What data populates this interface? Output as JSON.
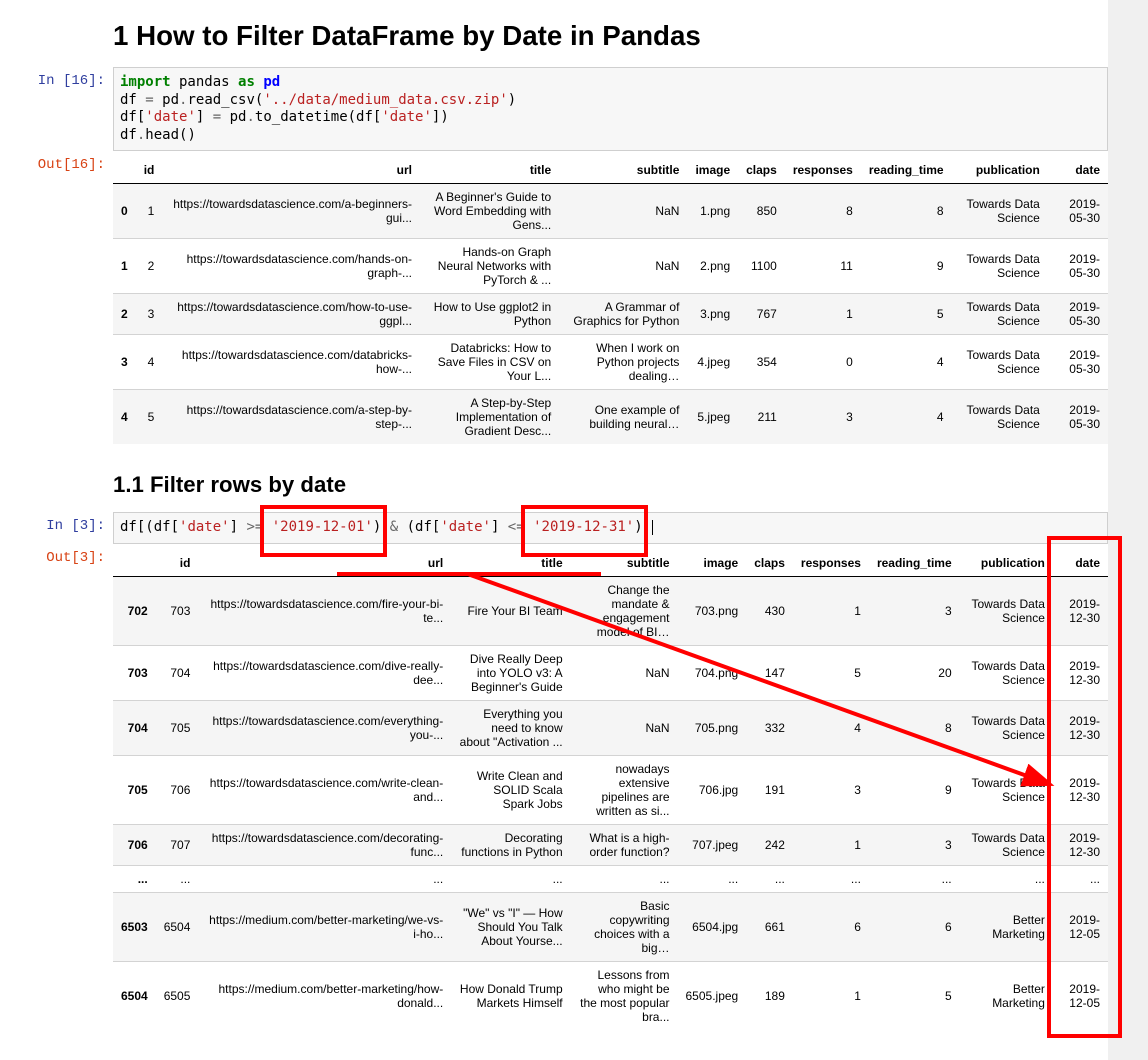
{
  "heading1": "1  How to Filter DataFrame by Date in Pandas",
  "heading11": "1.1  Filter rows by date",
  "prompt_in16": "In [16]:",
  "prompt_out16": "Out[16]:",
  "prompt_in3": "In [3]:",
  "prompt_out3": "Out[3]:",
  "code1": {
    "l1a": "import",
    "l1b": " pandas ",
    "l1c": "as",
    "l1d": " ",
    "l1e": "pd",
    "l2a": "df ",
    "l2b": "=",
    "l2c": " pd",
    "l2d": ".",
    "l2e": "read_csv(",
    "l2f": "'../data/medium_data.csv.zip'",
    "l2g": ")",
    "l3a": "df[",
    "l3b": "'date'",
    "l3c": "] ",
    "l3d": "=",
    "l3e": " pd",
    "l3f": ".",
    "l3g": "to_datetime(df[",
    "l3h": "'date'",
    "l3i": "])",
    "l4a": "df",
    "l4b": ".",
    "l4c": "head()"
  },
  "code2": {
    "a1": "df[(df[",
    "a2": "'date'",
    "a3": "] ",
    "a4": ">=",
    "a5": " ",
    "a6": "'2019-12-01'",
    "a7": ") ",
    "a8": "&",
    "a9": " (df[",
    "a10": "'date'",
    "a11": "] ",
    "a12": "<=",
    "a13": " ",
    "a14": "'2019-12-31'",
    "a15": ")]"
  },
  "t1_headers": [
    "",
    "id",
    "url",
    "title",
    "subtitle",
    "image",
    "claps",
    "responses",
    "reading_time",
    "publication",
    "date"
  ],
  "t2_headers": [
    "",
    "id",
    "url",
    "title",
    "subtitle",
    "image",
    "claps",
    "responses",
    "reading_time",
    "publication",
    "date"
  ],
  "t1": [
    {
      "idx": "0",
      "id": "1",
      "url": "https://towardsdatascience.com/a-beginners-gui...",
      "title": "A Beginner's Guide to Word Embedding with Gens...",
      "subtitle": "NaN",
      "image": "1.png",
      "claps": "850",
      "responses": "8",
      "reading_time": "8",
      "publication": "Towards Data Science",
      "date": "2019-05-30"
    },
    {
      "idx": "1",
      "id": "2",
      "url": "https://towardsdatascience.com/hands-on-graph-...",
      "title": "Hands-on Graph Neural Networks with PyTorch & ...",
      "subtitle": "NaN",
      "image": "2.png",
      "claps": "1100",
      "responses": "11",
      "reading_time": "9",
      "publication": "Towards Data Science",
      "date": "2019-05-30"
    },
    {
      "idx": "2",
      "id": "3",
      "url": "https://towardsdatascience.com/how-to-use-ggpl...",
      "title": "How to Use ggplot2 in Python",
      "subtitle": "A Grammar of Graphics for Python",
      "image": "3.png",
      "claps": "767",
      "responses": "1",
      "reading_time": "5",
      "publication": "Towards Data Science",
      "date": "2019-05-30"
    },
    {
      "idx": "3",
      "id": "4",
      "url": "https://towardsdatascience.com/databricks-how-...",
      "title": "Databricks: How to Save Files in CSV on Your L...",
      "subtitle": "When I work on Python projects dealing…",
      "image": "4.jpeg",
      "claps": "354",
      "responses": "0",
      "reading_time": "4",
      "publication": "Towards Data Science",
      "date": "2019-05-30"
    },
    {
      "idx": "4",
      "id": "5",
      "url": "https://towardsdatascience.com/a-step-by-step-...",
      "title": "A Step-by-Step Implementation of Gradient Desc...",
      "subtitle": "One example of building neural…",
      "image": "5.jpeg",
      "claps": "211",
      "responses": "3",
      "reading_time": "4",
      "publication": "Towards Data Science",
      "date": "2019-05-30"
    }
  ],
  "t2": [
    {
      "idx": "702",
      "id": "703",
      "url": "https://towardsdatascience.com/fire-your-bi-te...",
      "title": "Fire Your BI Team",
      "subtitle": "Change the mandate & engagement model of BI…",
      "image": "703.png",
      "claps": "430",
      "responses": "1",
      "reading_time": "3",
      "publication": "Towards Data Science",
      "date": "2019-12-30"
    },
    {
      "idx": "703",
      "id": "704",
      "url": "https://towardsdatascience.com/dive-really-dee...",
      "title": "Dive Really Deep into YOLO v3: A Beginner's Guide",
      "subtitle": "NaN",
      "image": "704.png",
      "claps": "147",
      "responses": "5",
      "reading_time": "20",
      "publication": "Towards Data Science",
      "date": "2019-12-30"
    },
    {
      "idx": "704",
      "id": "705",
      "url": "https://towardsdatascience.com/everything-you-...",
      "title": "Everything you need to know about \"Activation ...",
      "subtitle": "NaN",
      "image": "705.png",
      "claps": "332",
      "responses": "4",
      "reading_time": "8",
      "publication": "Towards Data Science",
      "date": "2019-12-30"
    },
    {
      "idx": "705",
      "id": "706",
      "url": "https://towardsdatascience.com/write-clean-and...",
      "title": "Write Clean and SOLID Scala Spark Jobs",
      "subtitle": "nowadays extensive pipelines are written as si...",
      "image": "706.jpg",
      "claps": "191",
      "responses": "3",
      "reading_time": "9",
      "publication": "Towards Data Science",
      "date": "2019-12-30"
    },
    {
      "idx": "706",
      "id": "707",
      "url": "https://towardsdatascience.com/decorating-func...",
      "title": "Decorating functions in Python",
      "subtitle": "What is a high-order function?",
      "image": "707.jpeg",
      "claps": "242",
      "responses": "1",
      "reading_time": "3",
      "publication": "Towards Data Science",
      "date": "2019-12-30"
    },
    {
      "idx": "...",
      "id": "...",
      "url": "...",
      "title": "...",
      "subtitle": "...",
      "image": "...",
      "claps": "...",
      "responses": "...",
      "reading_time": "...",
      "publication": "...",
      "date": "..."
    },
    {
      "idx": "6503",
      "id": "6504",
      "url": "https://medium.com/better-marketing/we-vs-i-ho...",
      "title": "\"We\" vs \"I\" — How Should You Talk About Yourse...",
      "subtitle": "Basic copywriting choices with a big…",
      "image": "6504.jpg",
      "claps": "661",
      "responses": "6",
      "reading_time": "6",
      "publication": "Better Marketing",
      "date": "2019-12-05"
    },
    {
      "idx": "6504",
      "id": "6505",
      "url": "https://medium.com/better-marketing/how-donald...",
      "title": "How Donald Trump Markets Himself",
      "subtitle": "Lessons from who might be the most popular bra...",
      "image": "6505.jpeg",
      "claps": "189",
      "responses": "1",
      "reading_time": "5",
      "publication": "Better Marketing",
      "date": "2019-12-05"
    }
  ]
}
